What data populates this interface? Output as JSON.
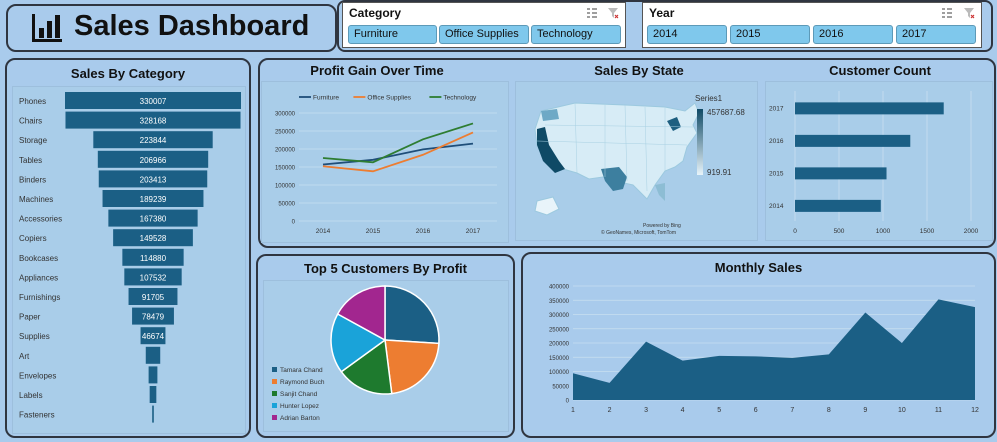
{
  "header": {
    "title": "Sales Dashboard",
    "icon": "bar-chart-icon"
  },
  "category_slicer": {
    "label": "Category",
    "items": [
      "Furniture",
      "Office Supplies",
      "Technology"
    ]
  },
  "year_slicer": {
    "label": "Year",
    "items": [
      "2014",
      "2015",
      "2016",
      "2017"
    ]
  },
  "colors": {
    "bar": "#1b5f85",
    "panel_bg": "#a9cbec",
    "border": "#2f3540"
  },
  "chart_data": [
    {
      "id": "sales_by_category",
      "type": "bar",
      "orientation": "horizontal-funnel",
      "title": "Sales By Category",
      "categories": [
        "Phones",
        "Chairs",
        "Storage",
        "Tables",
        "Binders",
        "Machines",
        "Accessories",
        "Copiers",
        "Bookcases",
        "Appliances",
        "Furnishings",
        "Paper",
        "Supplies",
        "Art",
        "Envelopes",
        "Labels",
        "Fasteners"
      ],
      "values": [
        330007,
        328168,
        223844,
        206966,
        203413,
        189239,
        167380,
        149528,
        114880,
        107532,
        91705,
        78479,
        46674,
        27119,
        16476,
        12486,
        3024
      ],
      "data_labels": [
        "330007",
        "328168",
        "223844",
        "206966",
        "203413",
        "189239",
        "167380",
        "149528",
        "114880",
        "107532",
        "91705",
        "78479",
        "46674",
        "",
        "",
        "",
        ""
      ]
    },
    {
      "id": "profit_gain",
      "type": "line",
      "title": "Profit Gain Over Time",
      "x": [
        "2014",
        "2015",
        "2016",
        "2017"
      ],
      "ylim": [
        0,
        300000
      ],
      "yticks": [
        "0",
        "50000",
        "100000",
        "150000",
        "200000",
        "250000",
        "300000"
      ],
      "series": [
        {
          "name": "Furniture",
          "color": "#1f4e79",
          "values": [
            157000,
            170000,
            199000,
            215000
          ]
        },
        {
          "name": "Office Supplies",
          "color": "#ed7d31",
          "values": [
            152000,
            138000,
            184000,
            246000
          ]
        },
        {
          "name": "Technology",
          "color": "#2e7d32",
          "values": [
            175000,
            163000,
            227000,
            271000
          ]
        }
      ],
      "legend": "top"
    },
    {
      "id": "sales_by_state",
      "type": "map",
      "title": "Sales By State",
      "legend_title": "Series1",
      "max": "457687.68",
      "min": "919.91",
      "attribution_1": "Powered by Bing",
      "attribution_2": "© GeoNames, Microsoft, TomTom"
    },
    {
      "id": "customer_count",
      "type": "bar",
      "orientation": "horizontal",
      "title": "Customer Count",
      "categories": [
        "2017",
        "2016",
        "2015",
        "2014"
      ],
      "values": [
        1690,
        1310,
        1040,
        975
      ],
      "xlim": [
        0,
        2000
      ],
      "xticks": [
        "0",
        "500",
        "1000",
        "1500",
        "2000"
      ]
    },
    {
      "id": "top_customers",
      "type": "pie",
      "title": "Top 5 Customers By Profit",
      "labels": [
        "Tamara Chand",
        "Raymond Buch",
        "Sanjit Chand",
        "Hunter Lopez",
        "Adrian Barton"
      ],
      "values": [
        26,
        22,
        17,
        18,
        17
      ],
      "colors": [
        "#1b5f85",
        "#ed7d31",
        "#1e7a2e",
        "#1aa3d9",
        "#a2268f"
      ]
    },
    {
      "id": "monthly_sales",
      "type": "area",
      "title": "Monthly Sales",
      "x": [
        "1",
        "2",
        "3",
        "4",
        "5",
        "6",
        "7",
        "8",
        "9",
        "10",
        "11",
        "12"
      ],
      "values": [
        94000,
        60000,
        205000,
        138000,
        155000,
        153000,
        148000,
        160000,
        307000,
        200000,
        353000,
        326000
      ],
      "ylim": [
        0,
        400000
      ],
      "yticks": [
        "0",
        "50000",
        "100000",
        "150000",
        "200000",
        "250000",
        "300000",
        "350000",
        "400000"
      ]
    }
  ]
}
